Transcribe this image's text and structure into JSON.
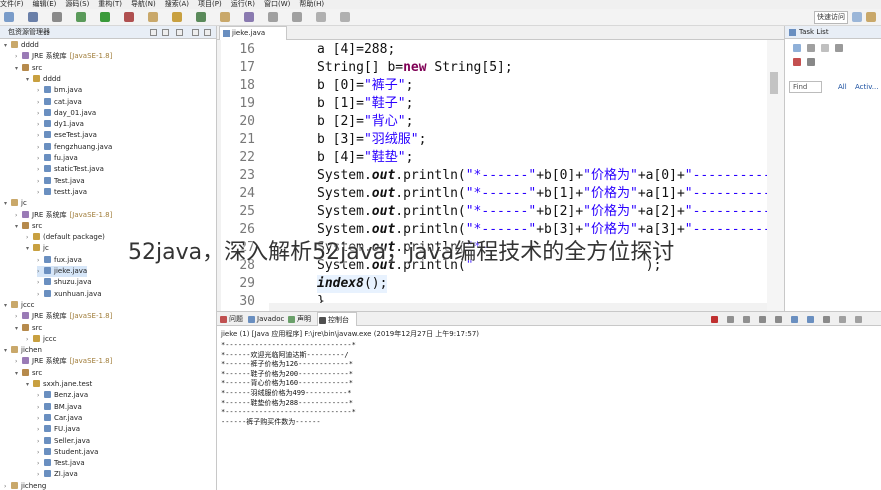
{
  "menubar": {
    "items": [
      "文件(F)",
      "编辑(E)",
      "源码(S)",
      "重构(T)",
      "导航(N)",
      "搜索(A)",
      "项目(P)",
      "运行(R)",
      "窗口(W)",
      "帮助(H)"
    ]
  },
  "toolbar": {
    "quick_access": "快速访问"
  },
  "explorer": {
    "title": "包资源管理器",
    "tree": [
      {
        "label": "dddd",
        "type": "project",
        "depth": 0,
        "arrow": "v"
      },
      {
        "label": "JRE 系统库",
        "deco": "[JavaSE-1.8]",
        "type": "lib",
        "depth": 1,
        "arrow": ">"
      },
      {
        "label": "src",
        "type": "src",
        "depth": 1,
        "arrow": "v"
      },
      {
        "label": "dddd",
        "type": "pkg",
        "depth": 2,
        "arrow": "v"
      },
      {
        "label": "bm.java",
        "type": "java",
        "depth": 3,
        "arrow": ">"
      },
      {
        "label": "cat.java",
        "type": "java",
        "depth": 3,
        "arrow": ">"
      },
      {
        "label": "day_01.java",
        "type": "java",
        "depth": 3,
        "arrow": ">"
      },
      {
        "label": "dy1.java",
        "type": "java",
        "depth": 3,
        "arrow": ">"
      },
      {
        "label": "eseTest.java",
        "type": "java",
        "depth": 3,
        "arrow": ">"
      },
      {
        "label": "fengzhuang.java",
        "type": "java",
        "depth": 3,
        "arrow": ">"
      },
      {
        "label": "fu.java",
        "type": "java",
        "depth": 3,
        "arrow": ">"
      },
      {
        "label": "staticTest.java",
        "type": "java",
        "depth": 3,
        "arrow": ">"
      },
      {
        "label": "Test.java",
        "type": "java",
        "depth": 3,
        "arrow": ">"
      },
      {
        "label": "testt.java",
        "type": "java",
        "depth": 3,
        "arrow": ">"
      },
      {
        "label": "jc",
        "type": "project",
        "depth": 0,
        "arrow": "v"
      },
      {
        "label": "JRE 系统库",
        "deco": "[JavaSE-1.8]",
        "type": "lib",
        "depth": 1,
        "arrow": ">"
      },
      {
        "label": "src",
        "type": "src",
        "depth": 1,
        "arrow": "v"
      },
      {
        "label": "(default package)",
        "type": "pkg",
        "depth": 2,
        "arrow": ">"
      },
      {
        "label": "jc",
        "type": "pkg",
        "depth": 2,
        "arrow": "v"
      },
      {
        "label": "fux.java",
        "type": "java",
        "depth": 3,
        "arrow": ">"
      },
      {
        "label": "jieke.java",
        "type": "java",
        "depth": 3,
        "arrow": ">",
        "selected": true
      },
      {
        "label": "shuzu.java",
        "type": "java",
        "depth": 3,
        "arrow": ">"
      },
      {
        "label": "xunhuan.java",
        "type": "java",
        "depth": 3,
        "arrow": ">"
      },
      {
        "label": "jccc",
        "type": "project",
        "depth": 0,
        "arrow": "v"
      },
      {
        "label": "JRE 系统库",
        "deco": "[JavaSE-1.8]",
        "type": "lib",
        "depth": 1,
        "arrow": ">"
      },
      {
        "label": "src",
        "type": "src",
        "depth": 1,
        "arrow": "v"
      },
      {
        "label": "jccc",
        "type": "pkg",
        "depth": 2,
        "arrow": ">"
      },
      {
        "label": "jichen",
        "type": "project",
        "depth": 0,
        "arrow": "v"
      },
      {
        "label": "JRE 系统库",
        "deco": "[JavaSE-1.8]",
        "type": "lib",
        "depth": 1,
        "arrow": ">"
      },
      {
        "label": "src",
        "type": "src",
        "depth": 1,
        "arrow": "v"
      },
      {
        "label": "sxxh.jane.test",
        "type": "pkg",
        "depth": 2,
        "arrow": "v"
      },
      {
        "label": "Benz.java",
        "type": "java",
        "depth": 3,
        "arrow": ">"
      },
      {
        "label": "BM.java",
        "type": "java",
        "depth": 3,
        "arrow": ">"
      },
      {
        "label": "Car.java",
        "type": "java",
        "depth": 3,
        "arrow": ">"
      },
      {
        "label": "FU.java",
        "type": "java",
        "depth": 3,
        "arrow": ">"
      },
      {
        "label": "Seller.java",
        "type": "java",
        "depth": 3,
        "arrow": ">"
      },
      {
        "label": "Student.java",
        "type": "java",
        "depth": 3,
        "arrow": ">"
      },
      {
        "label": "Test.java",
        "type": "java",
        "depth": 3,
        "arrow": ">"
      },
      {
        "label": "ZI.java",
        "type": "java",
        "depth": 3,
        "arrow": ">"
      },
      {
        "label": "jicheng",
        "type": "project",
        "depth": 0,
        "arrow": ">"
      }
    ]
  },
  "editor": {
    "tab_label": "jieke.java",
    "lines": [
      {
        "no": "16",
        "segments": [
          {
            "t": "a [4]=288;",
            "c": ""
          }
        ]
      },
      {
        "no": "17",
        "segments": [
          {
            "t": "String[] b=",
            "c": ""
          },
          {
            "t": "new",
            "c": "kw"
          },
          {
            "t": " String[5];",
            "c": ""
          }
        ]
      },
      {
        "no": "18",
        "segments": [
          {
            "t": "b [0]=",
            "c": ""
          },
          {
            "t": "\"裤子\"",
            "c": "str"
          },
          {
            "t": ";",
            "c": ""
          }
        ]
      },
      {
        "no": "19",
        "segments": [
          {
            "t": "b [1]=",
            "c": ""
          },
          {
            "t": "\"鞋子\"",
            "c": "str"
          },
          {
            "t": ";",
            "c": ""
          }
        ]
      },
      {
        "no": "20",
        "segments": [
          {
            "t": "b [2]=",
            "c": ""
          },
          {
            "t": "\"背心\"",
            "c": "str"
          },
          {
            "t": ";",
            "c": ""
          }
        ]
      },
      {
        "no": "21",
        "segments": [
          {
            "t": "b [3]=",
            "c": ""
          },
          {
            "t": "\"羽绒服\"",
            "c": "str"
          },
          {
            "t": ";",
            "c": ""
          }
        ]
      },
      {
        "no": "22",
        "segments": [
          {
            "t": "b [4]=",
            "c": ""
          },
          {
            "t": "\"鞋垫\"",
            "c": "str"
          },
          {
            "t": ";",
            "c": ""
          }
        ]
      },
      {
        "no": "23",
        "segments": [
          {
            "t": "System.",
            "c": ""
          },
          {
            "t": "out",
            "c": "italic"
          },
          {
            "t": ".println(",
            "c": ""
          },
          {
            "t": "\"*------\"",
            "c": "str"
          },
          {
            "t": "+b[0]+",
            "c": ""
          },
          {
            "t": "\"价格为\"",
            "c": "str"
          },
          {
            "t": "+a[0]+",
            "c": ""
          },
          {
            "t": "\"-----------",
            "c": "str"
          }
        ]
      },
      {
        "no": "24",
        "segments": [
          {
            "t": "System.",
            "c": ""
          },
          {
            "t": "out",
            "c": "italic"
          },
          {
            "t": ".println(",
            "c": ""
          },
          {
            "t": "\"*------\"",
            "c": "str"
          },
          {
            "t": "+b[1]+",
            "c": ""
          },
          {
            "t": "\"价格为\"",
            "c": "str"
          },
          {
            "t": "+a[1]+",
            "c": ""
          },
          {
            "t": "\"-----------",
            "c": "str"
          }
        ]
      },
      {
        "no": "25",
        "segments": [
          {
            "t": "System.",
            "c": ""
          },
          {
            "t": "out",
            "c": "italic"
          },
          {
            "t": ".println(",
            "c": ""
          },
          {
            "t": "\"*------\"",
            "c": "str"
          },
          {
            "t": "+b[2]+",
            "c": ""
          },
          {
            "t": "\"价格为\"",
            "c": "str"
          },
          {
            "t": "+a[2]+",
            "c": ""
          },
          {
            "t": "\"-----------",
            "c": "str"
          }
        ]
      },
      {
        "no": "26",
        "segments": [
          {
            "t": "System.",
            "c": ""
          },
          {
            "t": "out",
            "c": "italic"
          },
          {
            "t": ".println(",
            "c": ""
          },
          {
            "t": "\"*------\"",
            "c": "str"
          },
          {
            "t": "+b[3]+",
            "c": ""
          },
          {
            "t": "\"价格为\"",
            "c": "str"
          },
          {
            "t": "+a[3]+",
            "c": ""
          },
          {
            "t": "\"-----------",
            "c": "str"
          }
        ]
      },
      {
        "no": "27",
        "segments": [
          {
            "t": "System.",
            "c": ""
          },
          {
            "t": "out",
            "c": "italic"
          },
          {
            "t": ".println(",
            "c": ""
          },
          {
            "t": "\"*-",
            "c": "str"
          }
        ]
      },
      {
        "no": "28",
        "segments": [
          {
            "t": "System.",
            "c": ""
          },
          {
            "t": "out",
            "c": "italic"
          },
          {
            "t": ".println(",
            "c": ""
          },
          {
            "t": "\"",
            "c": "str"
          },
          {
            "t": "                      ",
            "c": ""
          },
          {
            "t": ");",
            "c": ""
          }
        ]
      },
      {
        "no": "29",
        "segments": [
          {
            "t": "index8",
            "c": "italic"
          },
          {
            "t": "();",
            "c": ""
          }
        ],
        "highlight": true
      },
      {
        "no": "30",
        "segments": [
          {
            "t": "}",
            "c": ""
          }
        ]
      }
    ]
  },
  "watermark": "52java，深入解析52java，java编程技术的全方位探讨",
  "tasklist": {
    "title": "Task List",
    "find_placeholder": "Find",
    "all_label": "All",
    "activate_label": "Activ..."
  },
  "console": {
    "tabs": [
      {
        "label": "问题",
        "active": false
      },
      {
        "label": "Javadoc",
        "active": false
      },
      {
        "label": "声明",
        "active": false
      },
      {
        "label": "控制台",
        "active": true
      }
    ],
    "header": "jieke (1)  [Java 应用程序] F:\\jre\\bin\\javaw.exe  (2019年12月27日 上午9:17:57)",
    "output": [
      "*------------------------------*",
      "*------欢迎光临阿迪达斯---------/",
      "*------裤子价格为126------------*",
      "*------鞋子价格为200------------*",
      "*------背心价格为160------------*",
      "*------羽绒服价格为499----------*",
      "*------鞋垫价格为288------------*",
      "*------------------------------*",
      "------裤子购买件数为------"
    ]
  }
}
